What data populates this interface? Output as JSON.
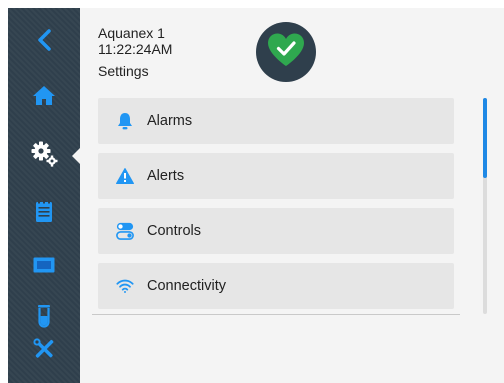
{
  "device": {
    "name": "Aquanex 1",
    "time": "11:22:24AM"
  },
  "page": {
    "title": "Settings"
  },
  "status": {
    "state": "ok",
    "color": "#2fa84f",
    "icon": "heart-check-icon"
  },
  "sidebar": {
    "active_item": "settings",
    "items": [
      {
        "id": "back",
        "icon": "chevron-left-icon",
        "color": "#2196f3"
      },
      {
        "id": "home",
        "icon": "home-icon",
        "color": "#2196f3"
      },
      {
        "id": "settings",
        "icon": "gears-icon",
        "color": "#ffffff"
      },
      {
        "id": "log",
        "icon": "notepad-icon",
        "color": "#2196f3"
      },
      {
        "id": "display",
        "icon": "screen-icon",
        "color": "#2196f3"
      },
      {
        "id": "sample",
        "icon": "test-tube-icon",
        "color": "#2196f3"
      },
      {
        "id": "tools",
        "icon": "tools-icon",
        "color": "#2196f3"
      }
    ]
  },
  "menu": {
    "items": [
      {
        "label": "Alarms",
        "icon": "bell-icon",
        "color": "#2196f3"
      },
      {
        "label": "Alerts",
        "icon": "warning-icon",
        "color": "#2196f3"
      },
      {
        "label": "Controls",
        "icon": "toggle-icon",
        "color": "#2196f3"
      },
      {
        "label": "Connectivity",
        "icon": "wifi-icon",
        "color": "#2196f3"
      }
    ]
  },
  "colors": {
    "sidebar_bg": "#2f3f4c",
    "accent": "#2196f3",
    "panel_bg": "#f4f4f4",
    "item_bg": "#e6e6e6"
  }
}
